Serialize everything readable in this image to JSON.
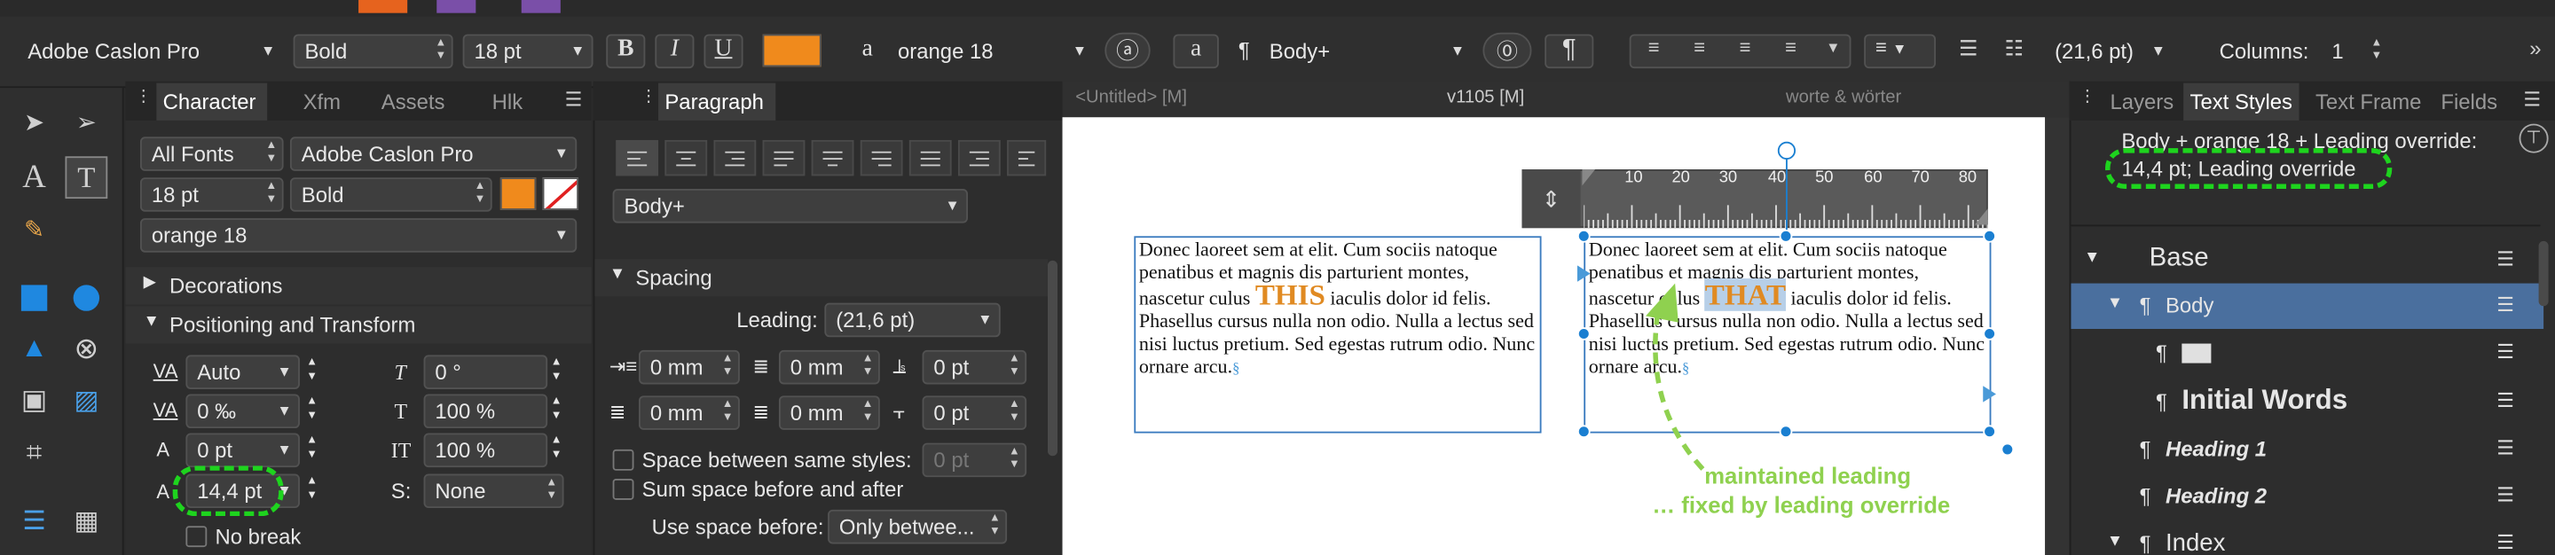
{
  "toolbar": {
    "font": "Adobe Caslon Pro",
    "weight": "Bold",
    "size": "18 pt",
    "bold": "B",
    "italic": "I",
    "underline": "U",
    "accent": "#f08a1c",
    "char_style_icon": "a",
    "char_style": "orange 18",
    "para_style": "Body+",
    "leading": "(21,6 pt)",
    "columns_label": "Columns:",
    "columns_value": "1"
  },
  "left_tabs": {
    "character": "Character",
    "xfm": "Xfm",
    "assets": "Assets",
    "hlk": "Hlk",
    "paragraph": "Paragraph"
  },
  "character": {
    "font_collection": "All Fonts",
    "font": "Adobe Caslon Pro",
    "size": "18 pt",
    "weight": "Bold",
    "style": "orange 18",
    "decorations": "Decorations",
    "pos_transform": "Positioning and Transform",
    "kerning": "Auto",
    "tracking": "0 ‰",
    "baseline": "0 pt",
    "leading": "14,4 pt",
    "no_break": "No break",
    "skew": "0 °",
    "hscale": "100 %",
    "vscale": "100 %",
    "shear_label": "S:",
    "shear": "None",
    "kern_label": "VA",
    "track_label": "VA",
    "base_label": "A",
    "lead_label": "A",
    "skew_label": "T",
    "hs_label": "T",
    "vs_label": "IT"
  },
  "paragraph": {
    "style": "Body+",
    "spacing": "Spacing",
    "leading_label": "Leading:",
    "leading": "(21,6 pt)",
    "indent_left": "0 mm",
    "indent_right": "0 mm",
    "space_before": "0 pt",
    "indent_first": "0 mm",
    "indent_last": "0 mm",
    "space_after": "0 pt",
    "same_styles": "Space between same styles:",
    "same_styles_val": "0 pt",
    "sum_space": "Sum space before and after",
    "use_space_label": "Use space before:",
    "use_space": "Only betwee..."
  },
  "doc_tabs": {
    "untitled": "<Untitled> [M]",
    "v1105": "v1105   [M]",
    "worte": "worte & wörter"
  },
  "ruler": {
    "ticks": [
      "10",
      "20",
      "30",
      "40",
      "50",
      "60",
      "70",
      "80"
    ]
  },
  "frames": {
    "text_before": "Donec laoreet sem at elit. Cum sociis natoque penatibus et magnis dis parturient montes, nascetur culus ",
    "word1": "THIS",
    "word2": "THAT",
    "text_after": " iaculis dolor id felis. Phasellus cursus nulla non odio. Nulla a lectus sed nisi luctus pretium. Sed egestas rutrum odio. Nunc ornare arcu.",
    "pilcrow": "§"
  },
  "annotation": {
    "line1": "maintained leading",
    "line2": "… fixed by leading override"
  },
  "right_tabs": {
    "layers": "Layers",
    "text_styles": "Text Styles",
    "text_frame": "Text Frame",
    "fields": "Fields"
  },
  "text_styles": {
    "current_line1": "Body + orange 18 + Leading override:",
    "current_line2": "14,4 pt; Leading override",
    "items": [
      "Base",
      "Body",
      "",
      "Initial Words",
      "Heading 1",
      "Heading 2",
      "Index"
    ],
    "pilcrow": "¶"
  }
}
